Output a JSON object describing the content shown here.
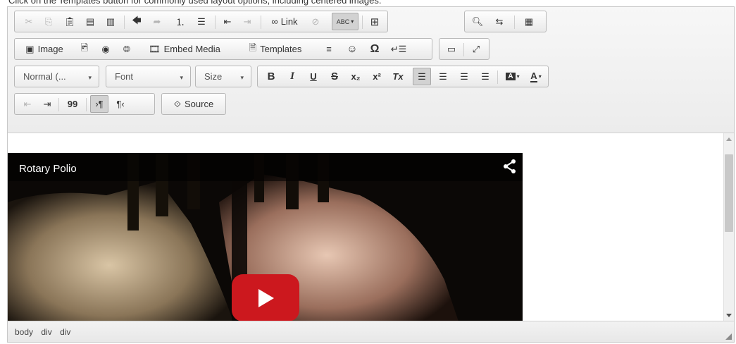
{
  "caption": "Click on the Templates button for commonly used layout options, including centered images.",
  "toolbar": {
    "link_label": "Link",
    "spell_label": "ABC",
    "image_label": "Image",
    "embed_label": "Embed Media",
    "templates_label": "Templates",
    "format_value": "Normal (...",
    "font_value": "Font",
    "size_value": "Size",
    "bold": "B",
    "italic": "I",
    "underline": "U",
    "strike": "S",
    "subscript": "x₂",
    "superscript": "x²",
    "clear_format": "Tx",
    "source_label": "Source",
    "text_color": "A",
    "bg_color_mark": "A",
    "omega": "Ω",
    "quote": "99"
  },
  "video": {
    "title": "Rotary Polio"
  },
  "status": {
    "path": [
      "body",
      "div",
      "div"
    ]
  },
  "colors": {
    "play": "#cc181e",
    "toolbar_bg": "#ececec"
  }
}
